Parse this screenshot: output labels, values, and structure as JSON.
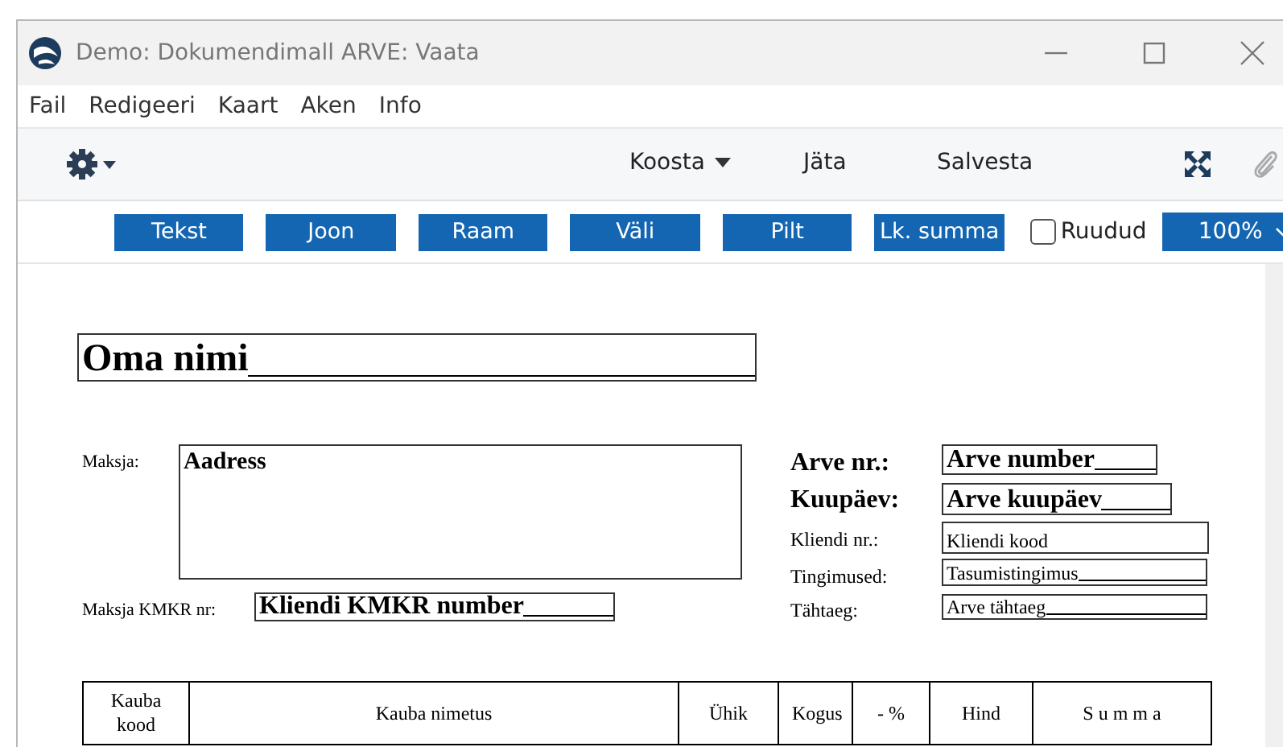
{
  "window": {
    "title": "Demo: Dokumendimall ARVE: Vaata"
  },
  "menu": [
    "Fail",
    "Redigeeri",
    "Kaart",
    "Aken",
    "Info"
  ],
  "toolbar": {
    "actions": [
      {
        "label": "Koosta",
        "kind": "dropdown"
      },
      {
        "label": "Jäta",
        "kind": "plain"
      },
      {
        "label": "Salvesta",
        "kind": "plain"
      }
    ]
  },
  "tools": [
    "Tekst",
    "Joon",
    "Raam",
    "Väli",
    "Pilt",
    "Lk. summa"
  ],
  "grid_checkbox": {
    "label": "Ruudud",
    "checked": false
  },
  "zoom": {
    "value": "100%"
  },
  "document": {
    "fields": [
      {
        "kind": "heading",
        "value": "Oma nimi",
        "filler_line": true
      },
      {
        "kind": "address",
        "label": "Maksja:",
        "value": "Aadress",
        "filler_line": false
      },
      {
        "kind": "bold",
        "label": "Maksja KMKR nr:",
        "value": "Kliendi KMKR number",
        "filler_line": true
      },
      {
        "kind": "bold",
        "label": "Arve nr.:",
        "label_bold": true,
        "value": "Arve number",
        "filler_line": true
      },
      {
        "kind": "bold",
        "label": "Kuupäev:",
        "label_bold": true,
        "value": "Arve kuupäev",
        "filler_line": true
      },
      {
        "kind": "plain",
        "label": "Kliendi nr.:",
        "label_bold": false,
        "value": "Kliendi kood",
        "filler_line": false
      },
      {
        "kind": "plain",
        "label": "Tingimused:",
        "label_bold": false,
        "value": "Tasumistingimus",
        "filler_line": true
      },
      {
        "kind": "plain",
        "label": "Tähtaeg:",
        "label_bold": false,
        "value": "Arve tähtaeg",
        "filler_line": true
      }
    ],
    "table": {
      "columns": [
        "Kauba kood",
        "Kauba nimetus",
        "Ühik",
        "Kogus",
        "- %",
        "Hind",
        "S u m m a"
      ]
    }
  }
}
